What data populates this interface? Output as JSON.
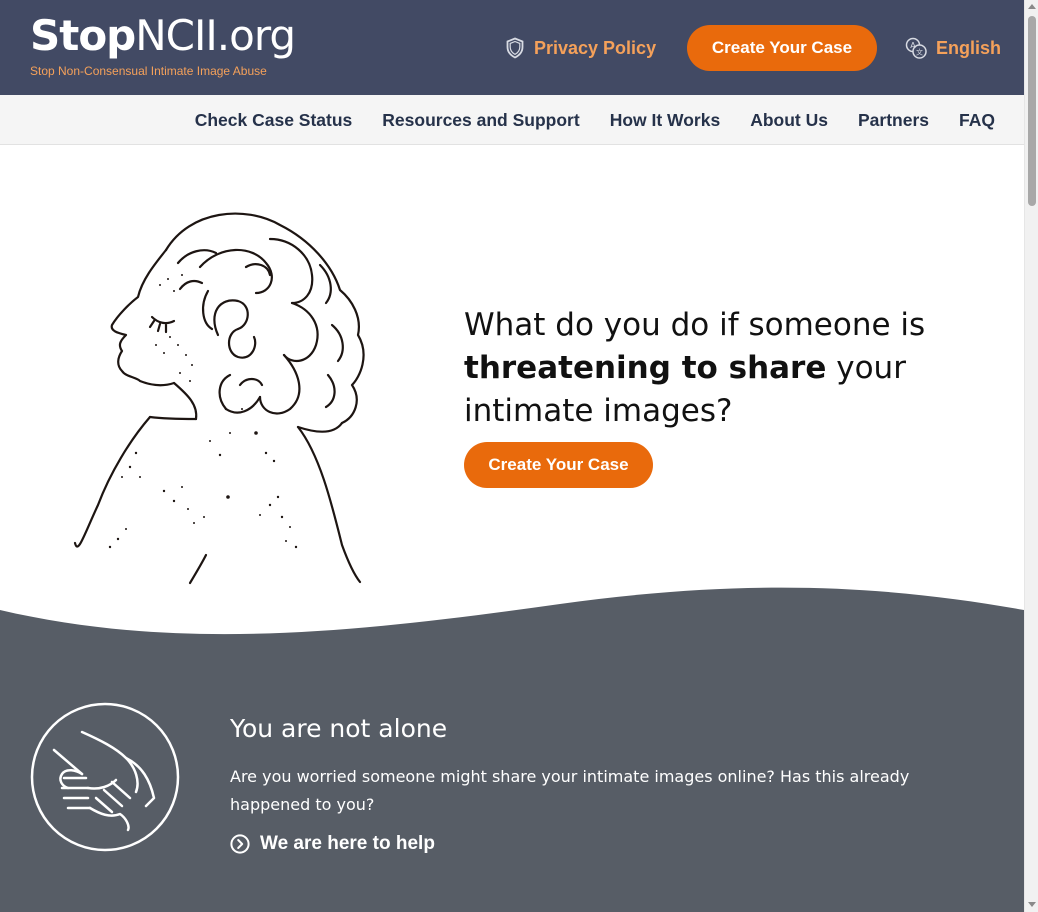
{
  "header": {
    "logo_bold": "Stop",
    "logo_light": "NCII.org",
    "tagline": "Stop Non-Consensual Intimate Image Abuse",
    "privacy_label": "Privacy Policy",
    "privacy_icon": "shield-icon",
    "cta_label": "Create Your Case",
    "language_label": "English",
    "language_icon": "translate-icon"
  },
  "nav": {
    "items": [
      "Check Case Status",
      "Resources and Support",
      "How It Works",
      "About Us",
      "Partners",
      "FAQ"
    ]
  },
  "hero": {
    "line1": "What do you do if someone is",
    "line2_bold": "threatening to share",
    "line2_rest": " your",
    "line3": "intimate images?",
    "cta_label": "Create Your Case"
  },
  "support": {
    "icon": "helping-hands-icon",
    "title": "You are not alone",
    "body": "Are you worried someone might share your intimate images online? Has this already happened to you?",
    "link_label": "We are here to help",
    "link_icon": "chevron-circle-right-icon"
  },
  "colors": {
    "header_bg": "#424a64",
    "accent_orange": "#e96a0c",
    "accent_light_orange": "#f5a15a",
    "nav_bg": "#f5f5f5",
    "nav_text": "#26324a",
    "section_grey": "#575d66"
  }
}
